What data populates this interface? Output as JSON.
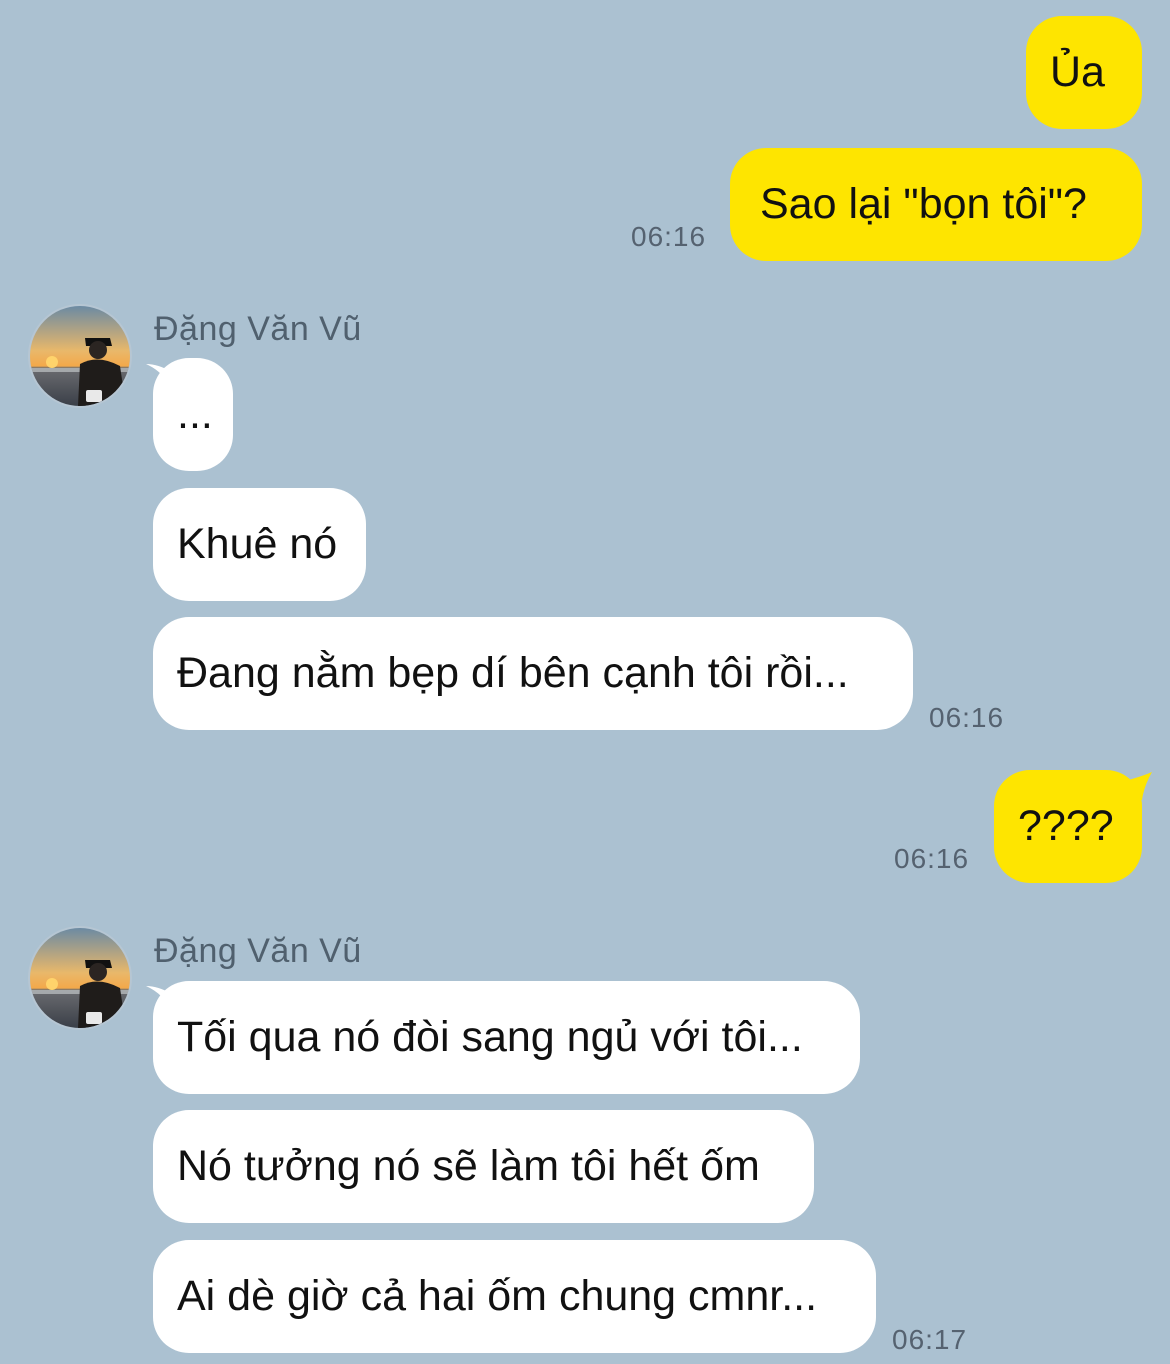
{
  "colors": {
    "background": "#abc1d1",
    "outgoing_bubble": "#fee500",
    "incoming_bubble": "#ffffff",
    "timestamp_text": "#556270",
    "sender_name_text": "#50606e"
  },
  "messages": {
    "m1": "Ủa",
    "m2": "Sao lại \"bọn tôi\"?",
    "m2_time": "06:16",
    "sender1": "Đặng Văn Vũ",
    "m3": "...",
    "m4": "Khuê nó",
    "m5": "Đang nằm bẹp dí bên cạnh tôi rồi...",
    "m5_time": "06:16",
    "m6": "????",
    "m6_time": "06:16",
    "sender2": "Đặng Văn Vũ",
    "m7": "Tối qua nó đòi sang ngủ với tôi...",
    "m8": "Nó tưởng nó sẽ làm tôi hết ốm",
    "m9": "Ai dè giờ cả hai ốm chung cmnr...",
    "m9_time": "06:17"
  },
  "icons": {
    "avatar": "profile-photo-person-at-sunset"
  }
}
